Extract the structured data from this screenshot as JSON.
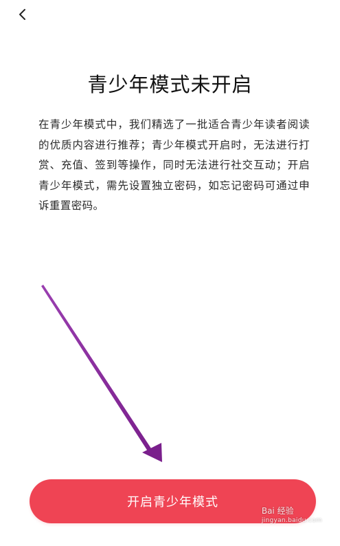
{
  "header": {
    "back_icon": "chevron-left-icon"
  },
  "main": {
    "title": "青少年模式未开启",
    "description": "在青少年模式中，我们精选了一批适合青少年读者阅读的优质内容进行推荐；青少年模式开启时，无法进行打赏、充值、签到等操作，同时无法进行社交互动；开启青少年模式，需先设置独立密码，如忘记密码可通过申诉重置密码。"
  },
  "actions": {
    "enable_label": "开启青少年模式"
  },
  "annotation": {
    "arrow_color": "#7a1f8c"
  },
  "watermark": {
    "logo_text": "Bai 经验",
    "sub_text": "jingyan.baidu.com"
  },
  "colors": {
    "accent": "#ef4454",
    "text": "#1a1a1a"
  }
}
